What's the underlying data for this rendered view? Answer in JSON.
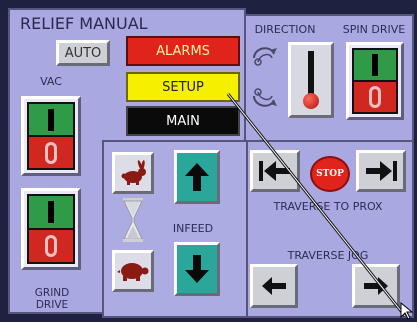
{
  "title": "RELIEF MANUAL",
  "buttons": {
    "auto": "AUTO",
    "alarms": "ALARMS",
    "setup": "SETUP",
    "main": "MAIN"
  },
  "labels": {
    "vac": "VAC",
    "grind_drive": "GRIND DRIVE",
    "direction": "DIRECTION",
    "spin_drive": "SPIN DRIVE",
    "infeed": "INFEED",
    "traverse_to_prox": "TRAVERSE TO PROX",
    "traverse_jog": "TRAVERSE JOG",
    "stop": "STOP"
  },
  "switch": {
    "on": "I",
    "off": "0"
  },
  "colors": {
    "panel": "#a9a8e0",
    "alarms": "#e0241c",
    "setup": "#f4f000",
    "main": "#0a0a0a",
    "switch_on": "#2f9a48",
    "switch_off": "#d02820",
    "infeed_arrows": "#2aa69a"
  },
  "icons": {
    "fast": "rabbit-icon",
    "slow": "turtle-icon",
    "speed": "hourglass-icon",
    "dir_cw": "rotation-cw-icon",
    "dir_ccw": "rotation-ccw-icon"
  }
}
